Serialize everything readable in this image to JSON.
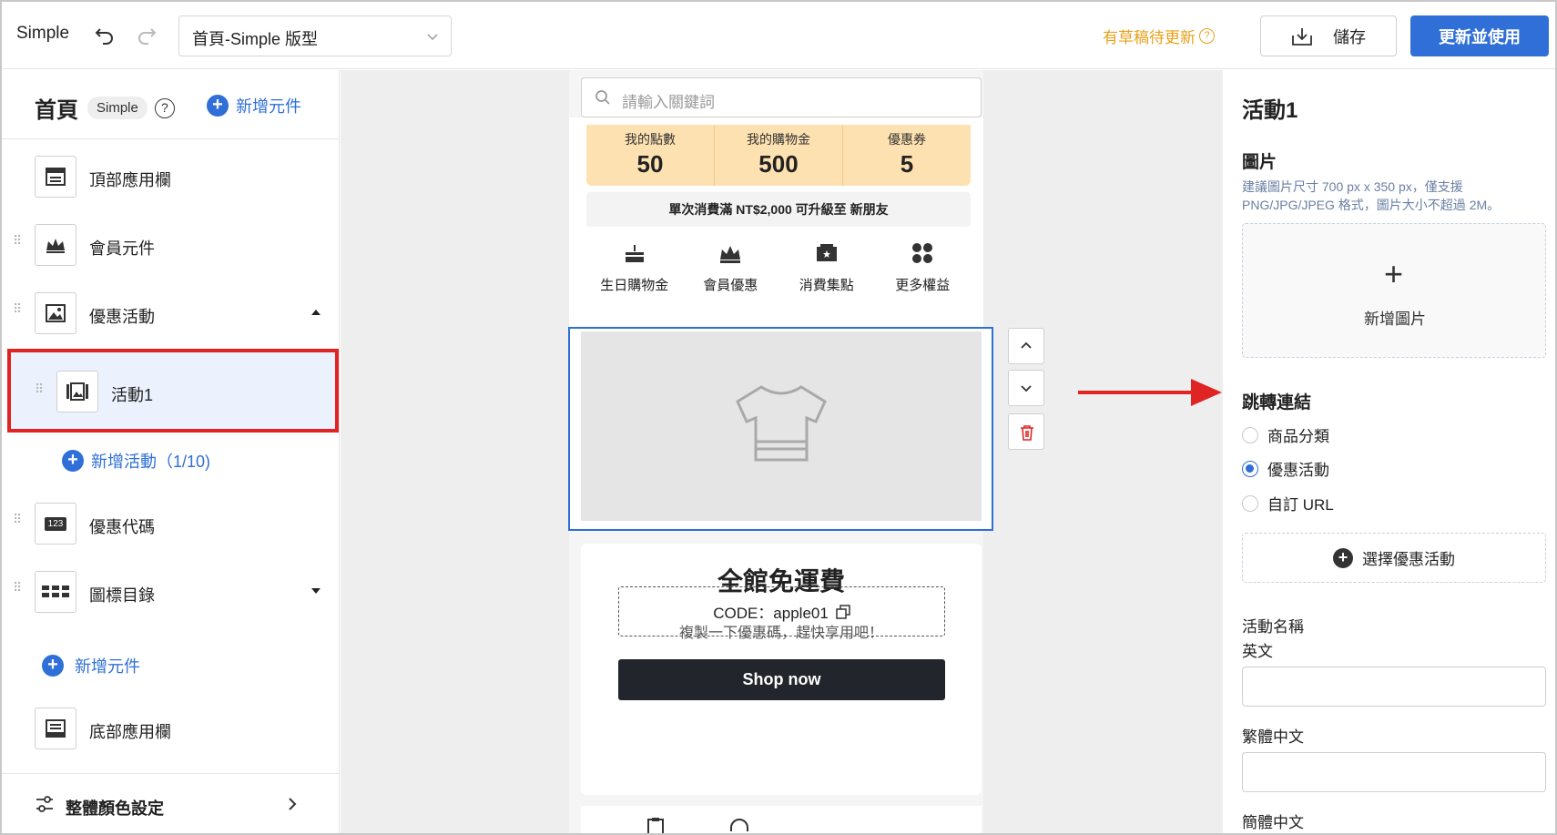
{
  "topbar": {
    "app_name": "Simple",
    "page_select_value": "首頁-Simple 版型",
    "draft_notice": "有草稿待更新",
    "draft_help": "?",
    "save_label": "儲存",
    "publish_label": "更新並使用"
  },
  "left": {
    "title": "首頁",
    "badge": "Simple",
    "help": "?",
    "add_component": "新增元件",
    "components": [
      {
        "label": "頂部應用欄",
        "icon": "app-bar-icon"
      },
      {
        "label": "會員元件",
        "icon": "crown-icon"
      },
      {
        "label": "優惠活動",
        "icon": "image-icon",
        "expanded": true
      },
      {
        "label": "活動1",
        "icon": "gallery-icon",
        "selected": true
      },
      {
        "label": "優惠代碼",
        "icon": "coupon-code-icon",
        "icon_text": "123"
      },
      {
        "label": "圖標目錄",
        "icon": "icon-grid-icon",
        "expanded": false
      },
      {
        "label": "底部應用欄",
        "icon": "bottom-bar-icon"
      }
    ],
    "add_activity": "新增活動（1/10)",
    "add_component_bottom": "新增元件",
    "footer_label": "整體顏色設定"
  },
  "canvas": {
    "search_placeholder": "請輸入關鍵詞",
    "points": [
      {
        "label": "我的點數",
        "value": "50"
      },
      {
        "label": "我的購物金",
        "value": "500"
      },
      {
        "label": "優惠券",
        "value": "5"
      }
    ],
    "upgrade_notice": "單次消費滿 NT$2,000 可升級至 新朋友",
    "perks": [
      {
        "label": "生日購物金",
        "icon": "birthday-cake-icon"
      },
      {
        "label": "會員優惠",
        "icon": "crown-icon"
      },
      {
        "label": "消費集點",
        "icon": "ticket-icon"
      },
      {
        "label": "更多權益",
        "icon": "more-grid-icon"
      }
    ],
    "coupon_title": "全館免運費",
    "coupon_subtitle": "複製一下優惠碼，趕快享用吧！",
    "coupon_code": "CODE：apple01",
    "shop_button": "Shop now"
  },
  "right": {
    "title": "活動1",
    "image_heading": "圖片",
    "image_hint": "建議圖片尺寸 700 px x 350 px，僅支援 PNG/JPG/JPEG 格式，圖片大小不超過 2M。",
    "add_image": "新增圖片",
    "link_heading": "跳轉連結",
    "link_options": [
      {
        "label": "商品分類",
        "checked": false
      },
      {
        "label": "優惠活動",
        "checked": true
      },
      {
        "label": "自訂 URL",
        "checked": false
      }
    ],
    "choose_promo": "選擇優惠活動",
    "name_heading": "活動名稱",
    "lang_en": "英文",
    "lang_tc": "繁體中文",
    "lang_sc": "簡體中文"
  },
  "colors": {
    "accent": "#2f6fd7",
    "draft": "#e7a11a",
    "highlight_border": "#e02424",
    "points_bg": "#fde1b0"
  }
}
